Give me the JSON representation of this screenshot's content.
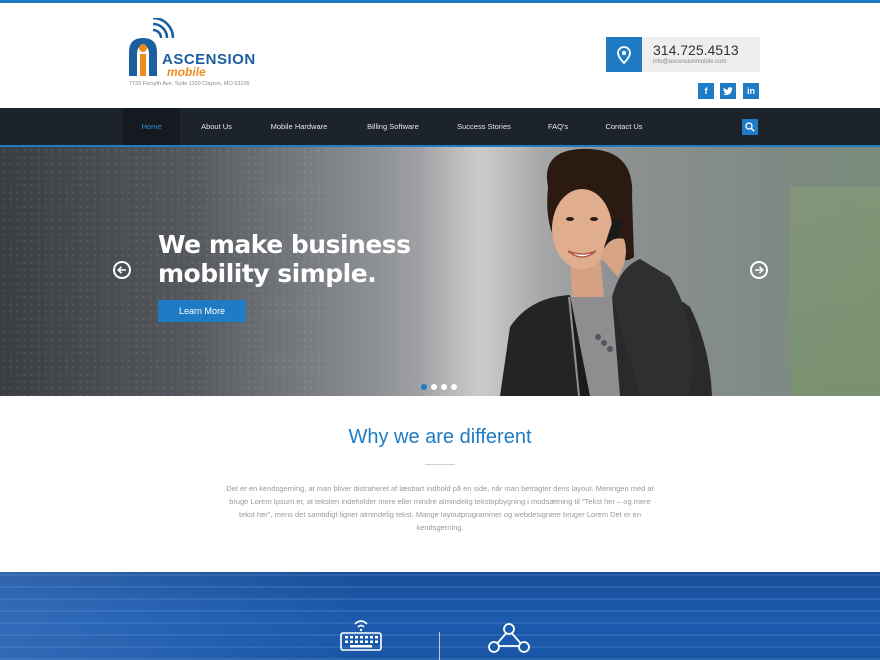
{
  "brand": {
    "name_line1": "ASCENSION",
    "name_line2": "mobile",
    "address": "7733 Forsyth Ave. Suite 1100 Clayton, MO 63105",
    "primary_color": "#1f7cc4",
    "accent_color": "#ef8b1c"
  },
  "contact": {
    "phone": "314.725.4513",
    "email": "info@ascensionmobile.com",
    "icon": "location-pin-icon"
  },
  "social": [
    {
      "label": "f",
      "icon": "facebook-icon"
    },
    {
      "label": "t",
      "icon": "twitter-icon"
    },
    {
      "label": "in",
      "icon": "linkedin-icon"
    }
  ],
  "nav": {
    "items": [
      {
        "label": "Home",
        "active": true
      },
      {
        "label": "About Us"
      },
      {
        "label": "Mobile Hardware"
      },
      {
        "label": "Billing Software"
      },
      {
        "label": "Success Stories"
      },
      {
        "label": "FAQ's"
      },
      {
        "label": "Contact Us"
      }
    ],
    "search_icon": "search-icon"
  },
  "hero": {
    "title": "We make business mobility simple.",
    "button_label": "Learn More",
    "slide_count": 4,
    "active_slide": 1
  },
  "why": {
    "title": "Why we are different",
    "body": "Det er en kendsgerning, at man bliver distraheret af læsbart indhold på en side, når man betragter dens layout. Meningen med at bruge Lorem Ipsum er, at teksten indeholder mere eller mindre almindelig tekstopbygning i modsætning til \"Tekst her – og mere tekst her\", mens det samtidigt ligner almindelig tekst. Mange layoutprogrammer og webdesignere bruger Lorem Det er en kendsgerning."
  },
  "features": {
    "icons": [
      "keyboard-wireless-icon",
      "network-share-icon"
    ]
  }
}
